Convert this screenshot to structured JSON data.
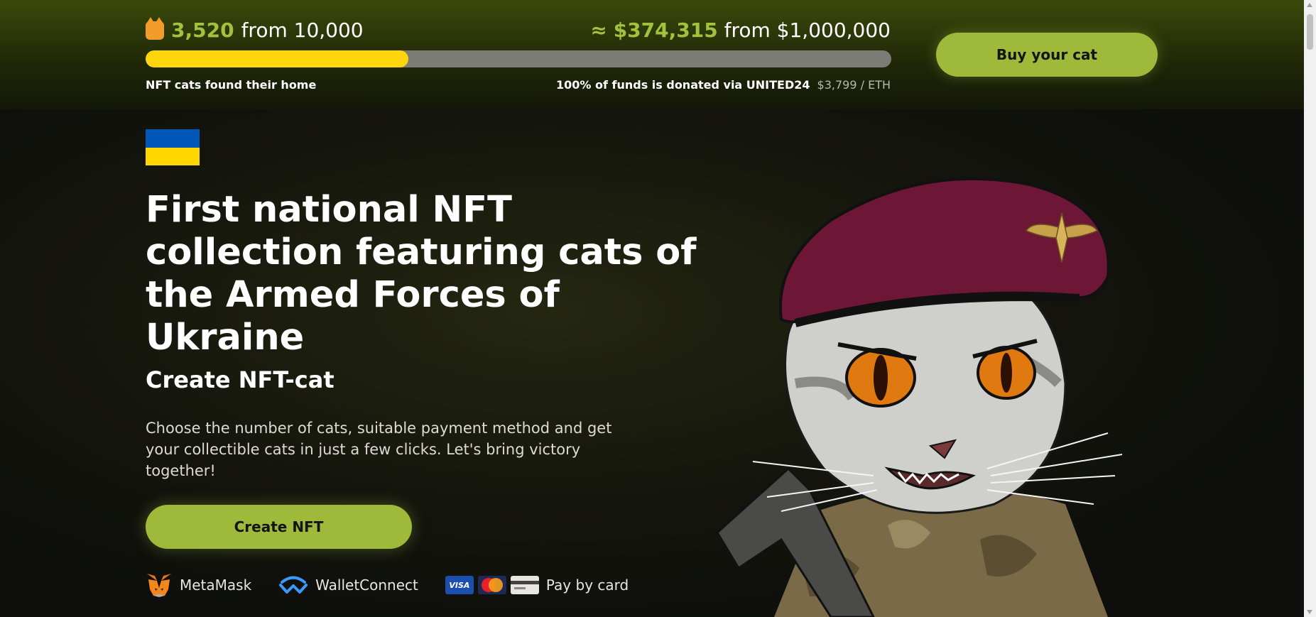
{
  "progress_bar": {
    "found_count": "3,520",
    "found_total_label": "from 10,000",
    "found_caption": "NFT cats found their home",
    "raised_prefix": "≈",
    "raised_amount": "$374,315",
    "raised_goal_label": "from $1,000,000",
    "donation_caption": "100% of funds is donated via UNITED24",
    "eth_rate": "$3,799 / ETH",
    "fill_fraction": 0.352,
    "fill_color": "#ffd60b",
    "accent_color": "#a3c13d"
  },
  "header": {
    "buy_button_label": "Buy your cat"
  },
  "hero": {
    "flag_colors": [
      "#0057b7",
      "#ffd700"
    ],
    "headline": "First national NFT collection featuring cats of the Armed Forces of Ukraine",
    "create_title": "Create NFT-cat",
    "description": "Choose the number of cats, suitable payment method and get your collectible cats in just a few clicks. Let's bring victory together!",
    "create_button_label": "Create NFT"
  },
  "payments": {
    "metamask_label": "MetaMask",
    "walletconnect_label": "WalletConnect",
    "card_label": "Pay by card",
    "visa_text": "VISA"
  },
  "icons": {
    "cat_emoji": "cat-face-icon",
    "metamask": "fox-icon",
    "walletconnect": "walletconnect-icon"
  },
  "colors": {
    "button_green": "#9fba3b",
    "beret": "#6e1636"
  }
}
